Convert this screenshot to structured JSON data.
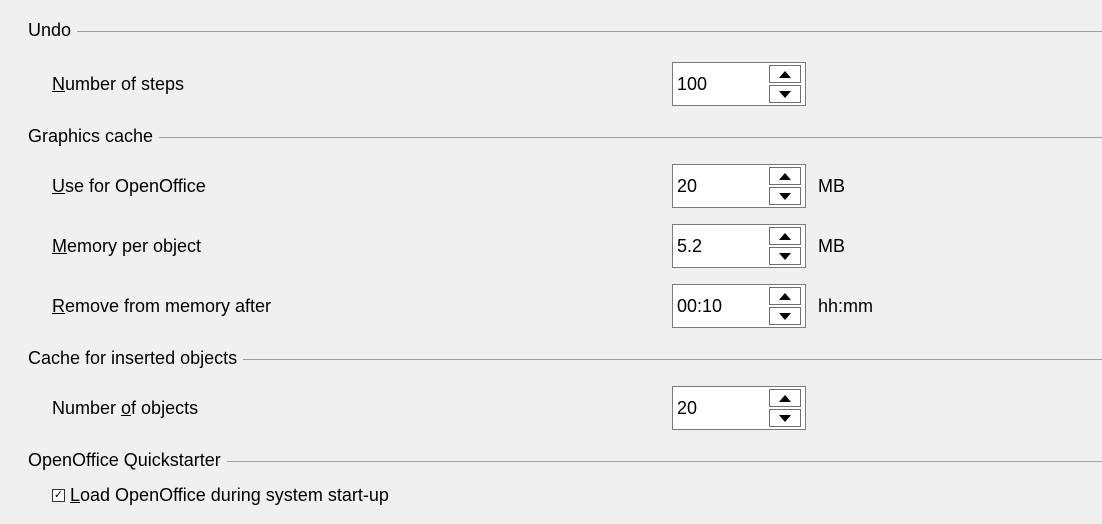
{
  "undo": {
    "header": "Undo",
    "steps": {
      "label_accel": "N",
      "label_rest": "umber of steps",
      "value": "100"
    }
  },
  "graphics_cache": {
    "header": "Graphics cache",
    "use_for": {
      "label_accel": "U",
      "label_rest": "se for OpenOffice",
      "value": "20",
      "unit": "MB"
    },
    "memory_per_object": {
      "label_accel": "M",
      "label_rest": "emory per object",
      "value": "5.2",
      "unit": "MB"
    },
    "remove_after": {
      "label_accel": "R",
      "label_rest": "emove from memory after",
      "value": "00:10",
      "unit": "hh:mm"
    }
  },
  "inserted_cache": {
    "header": "Cache for inserted objects",
    "objects": {
      "label_pre": "Number ",
      "label_accel": "o",
      "label_rest": "f objects",
      "value": "20"
    }
  },
  "quickstarter": {
    "header": "OpenOffice Quickstarter",
    "load": {
      "checked": true,
      "check_glyph": "✓",
      "label_accel": "L",
      "label_rest": "oad OpenOffice during system start-up"
    }
  }
}
